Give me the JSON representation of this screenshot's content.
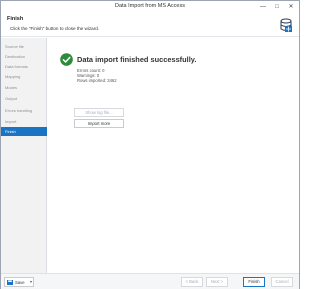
{
  "window": {
    "title": "Data Import from MS Access",
    "controls": {
      "minimize": "—",
      "maximize": "□",
      "close": "✕"
    }
  },
  "header": {
    "title": "Finish",
    "description": "Click the \"Finish\" button to close the wizard.",
    "icon": "database-wizard-icon"
  },
  "sidebar": {
    "items": [
      {
        "label": "Source file",
        "active": false
      },
      {
        "label": "Destination",
        "active": false
      },
      {
        "label": "Data formats",
        "active": false
      },
      {
        "label": "Mapping",
        "active": false
      },
      {
        "label": "Modes",
        "active": false
      },
      {
        "label": "Output",
        "active": false
      },
      {
        "label": "Errors handling",
        "active": false
      },
      {
        "label": "Import",
        "active": false
      },
      {
        "label": "Finish",
        "active": true
      }
    ]
  },
  "main": {
    "status_icon": "check-circle-icon",
    "status_color": "#2e8b3a",
    "headline": "Data import finished successfully.",
    "stats": {
      "errors": "Errors count: 0",
      "warnings": "Warnings: 0",
      "rows": "Rows imported: 3462"
    },
    "buttons": {
      "show_log": "Show log file...",
      "import_more": "Import more"
    }
  },
  "footer": {
    "save_label": "Save",
    "back_label": "< Back",
    "next_label": "Next >",
    "finish_label": "Finish",
    "cancel_label": "Cancel"
  },
  "colors": {
    "accent": "#1a74c4",
    "sidebar_bg": "#f2f2f2",
    "success": "#2e8b3a"
  }
}
